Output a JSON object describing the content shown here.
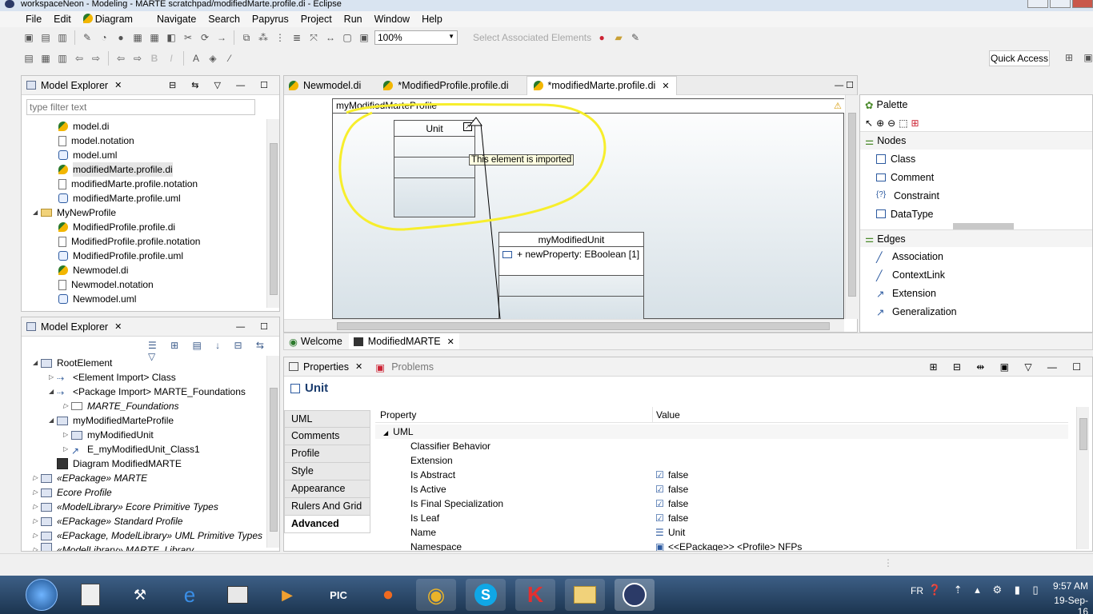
{
  "window": {
    "title": "workspaceNeon - Modeling - MARTE scratchpad/modifiedMarte.profile.di - Eclipse"
  },
  "menu": [
    "File",
    "Edit",
    "Diagram",
    "Navigate",
    "Search",
    "Papyrus",
    "Project",
    "Run",
    "Window",
    "Help"
  ],
  "toolbar": {
    "zoom": "100%",
    "select_associated": "Select Associated Elements",
    "quick_access": "Quick Access"
  },
  "explorer_top": {
    "title": "Model Explorer",
    "filter_placeholder": "type filter text",
    "items": [
      {
        "label": "model.di",
        "icon": "papyrus-di-icon"
      },
      {
        "label": "model.notation",
        "icon": "notation-file-icon"
      },
      {
        "label": "model.uml",
        "icon": "uml-file-icon"
      },
      {
        "label": "modifiedMarte.profile.di",
        "icon": "papyrus-di-icon"
      },
      {
        "label": "modifiedMarte.profile.notation",
        "icon": "notation-file-icon"
      },
      {
        "label": "modifiedMarte.profile.uml",
        "icon": "uml-file-icon"
      },
      {
        "label": "MyNewProfile",
        "icon": "folder-icon"
      },
      {
        "label": "ModifiedProfile.profile.di",
        "icon": "papyrus-di-icon"
      },
      {
        "label": "ModifiedProfile.profile.notation",
        "icon": "notation-file-icon"
      },
      {
        "label": "ModifiedProfile.profile.uml",
        "icon": "uml-file-icon"
      },
      {
        "label": "Newmodel.di",
        "icon": "papyrus-di-icon"
      },
      {
        "label": "Newmodel.notation",
        "icon": "notation-file-icon"
      },
      {
        "label": "Newmodel.uml",
        "icon": "uml-file-icon"
      }
    ]
  },
  "explorer_bottom": {
    "title": "Model Explorer",
    "items": [
      {
        "label": "RootElement"
      },
      {
        "label": "<Element Import> Class"
      },
      {
        "label": "<Package Import> MARTE_Foundations"
      },
      {
        "label": "MARTE_Foundations"
      },
      {
        "label": "myModifiedMarteProfile"
      },
      {
        "label": "myModifiedUnit"
      },
      {
        "label": "E_myModifiedUnit_Class1"
      },
      {
        "label": "Diagram ModifiedMARTE"
      },
      {
        "label": "«EPackage» MARTE"
      },
      {
        "label": "Ecore Profile"
      },
      {
        "label": "«ModelLibrary» Ecore Primitive Types"
      },
      {
        "label": "«EPackage» Standard Profile"
      },
      {
        "label": "«EPackage, ModelLibrary» UML Primitive Types"
      },
      {
        "label": "«ModelLibrary» MARTE_Library"
      }
    ]
  },
  "editor": {
    "tabs": [
      "Newmodel.di",
      "*ModifiedProfile.profile.di",
      "*modifiedMarte.profile.di"
    ],
    "diagram_title": "myModifiedMarteProfile",
    "unit_class": "Unit",
    "tooltip": "This element is imported",
    "modified_unit_class": "myModifiedUnit",
    "modified_unit_property": "+ newProperty: EBoolean [1]",
    "bottom_tabs": [
      "Welcome",
      "ModifiedMARTE"
    ]
  },
  "palette": {
    "title": "Palette",
    "nodes_label": "Nodes",
    "nodes": [
      "Class",
      "Comment",
      "Constraint",
      "DataType"
    ],
    "edges_label": "Edges",
    "edges": [
      "Association",
      "ContextLink",
      "Extension",
      "Generalization"
    ]
  },
  "properties": {
    "tab_label": "Properties",
    "problems_label": "Problems",
    "selected": "Unit",
    "side_tabs": [
      "UML",
      "Comments",
      "Profile",
      "Style",
      "Appearance",
      "Rulers And Grid",
      "Advanced"
    ],
    "col_property": "Property",
    "col_value": "Value",
    "group": "UML",
    "rows": [
      {
        "property": "Classifier Behavior",
        "value": ""
      },
      {
        "property": "Extension",
        "value": ""
      },
      {
        "property": "Is Abstract",
        "value": "false"
      },
      {
        "property": "Is Active",
        "value": "false"
      },
      {
        "property": "Is Final Specialization",
        "value": "false"
      },
      {
        "property": "Is Leaf",
        "value": "false"
      },
      {
        "property": "Name",
        "value": "Unit"
      },
      {
        "property": "Namespace",
        "value": "<<EPackage>> <Profile> NFPs"
      }
    ]
  },
  "taskbar": {
    "lang": "FR",
    "time": "9:57 AM",
    "date": "19-Sep-16"
  }
}
